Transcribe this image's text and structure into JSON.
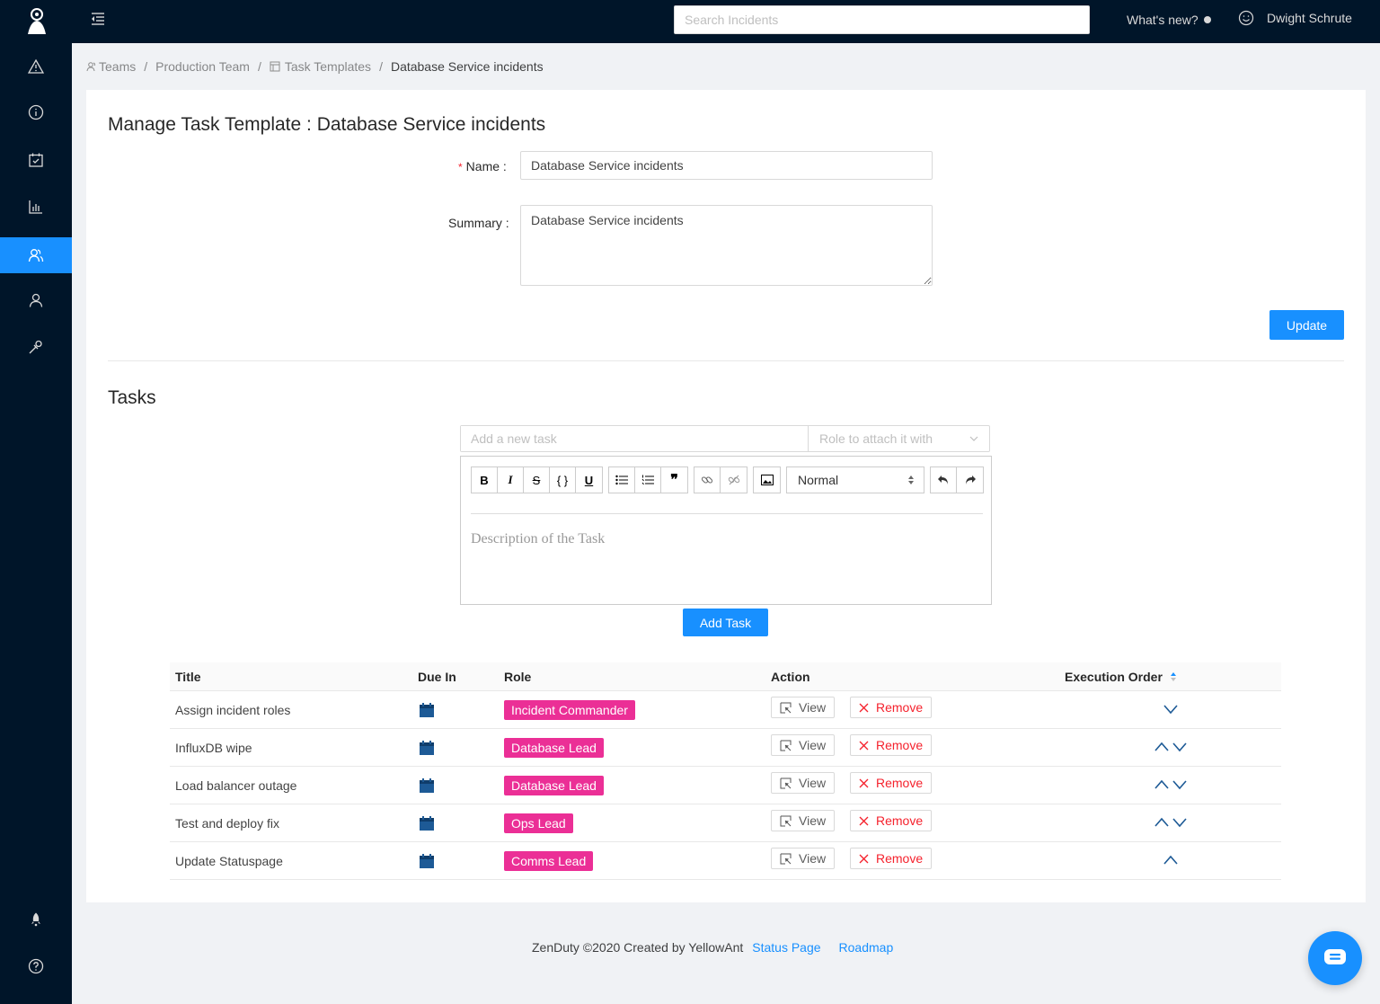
{
  "topbar": {
    "search_placeholder": "Search Incidents",
    "whats_new": "What's new?",
    "user_name": "Dwight Schrute"
  },
  "breadcrumb": {
    "teams": "Teams",
    "team": "Production Team",
    "templates": "Task Templates",
    "current": "Database Service incidents"
  },
  "form": {
    "title": "Manage Task Template : Database Service incidents",
    "name_label": "Name",
    "name_value": "Database Service incidents",
    "summary_label": "Summary",
    "summary_value": "Database Service incidents",
    "update_label": "Update"
  },
  "tasks": {
    "title": "Tasks",
    "new_task_placeholder": "Add a new task",
    "role_placeholder": "Role to attach it with",
    "editor_block_type": "Normal",
    "editor_placeholder": "Description of the Task",
    "add_task_label": "Add Task"
  },
  "table": {
    "headers": {
      "title": "Title",
      "due": "Due In",
      "role": "Role",
      "action": "Action",
      "order": "Execution Order"
    },
    "view_label": "View",
    "remove_label": "Remove",
    "rows": [
      {
        "title": "Assign incident roles",
        "role": "Incident Commander",
        "up": false,
        "down": true
      },
      {
        "title": "InfluxDB wipe",
        "role": "Database Lead",
        "up": true,
        "down": true
      },
      {
        "title": "Load balancer outage",
        "role": "Database Lead",
        "up": true,
        "down": true
      },
      {
        "title": "Test and deploy fix",
        "role": "Ops Lead",
        "up": true,
        "down": true
      },
      {
        "title": "Update Statuspage",
        "role": "Comms Lead",
        "up": true,
        "down": false
      }
    ]
  },
  "footer": {
    "copyright": "ZenDuty ©2020 Created by YellowAnt",
    "status_link": "Status Page",
    "roadmap_link": "Roadmap"
  },
  "colors": {
    "sidebar": "#001529",
    "primary": "#1890ff",
    "tag": "#eb2f96",
    "danger": "#f5222d",
    "calendar": "#1d5a96"
  }
}
